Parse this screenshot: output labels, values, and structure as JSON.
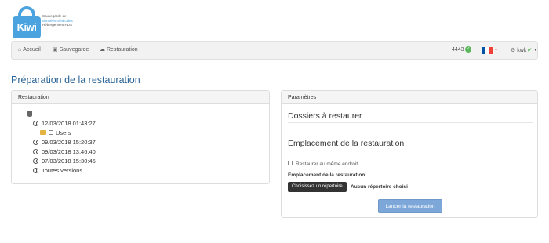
{
  "logo": {
    "brand": "Kiwi",
    "line1": "Sauvegarde de",
    "line2": "données médicales",
    "line3": "Hébergement HDS"
  },
  "nav": {
    "home": "Accueil",
    "backup": "Sauvegarde",
    "restore": "Restauration",
    "status_count": "4443",
    "user": "kwk"
  },
  "page": {
    "title": "Préparation de la restauration"
  },
  "left_panel": {
    "heading": "Restauration",
    "tree": [
      {
        "label": "12/03/2018 01:43:27"
      },
      {
        "label": "Users"
      },
      {
        "label": "09/03/2018 15:20:37"
      },
      {
        "label": "09/03/2018 13:46:40"
      },
      {
        "label": "07/03/2018 15:30:45"
      },
      {
        "label": "Toutes versions"
      }
    ]
  },
  "right_panel": {
    "heading": "Paramètres",
    "folders_title": "Dossiers à restaurer",
    "location_title": "Emplacement de la restauration",
    "same_place_label": "Restaurer au même endroit",
    "location_field_label": "Emplacement de la restauration",
    "choose_button": "Choisissez un répertoire",
    "no_dir": "Aucun répertoire choisi",
    "launch_button": "Lancer la restauration"
  },
  "colors": {
    "accent": "#2a6496",
    "logo": "#4aa3df",
    "ok": "#5cb85c",
    "launch": "#7da7d9"
  }
}
